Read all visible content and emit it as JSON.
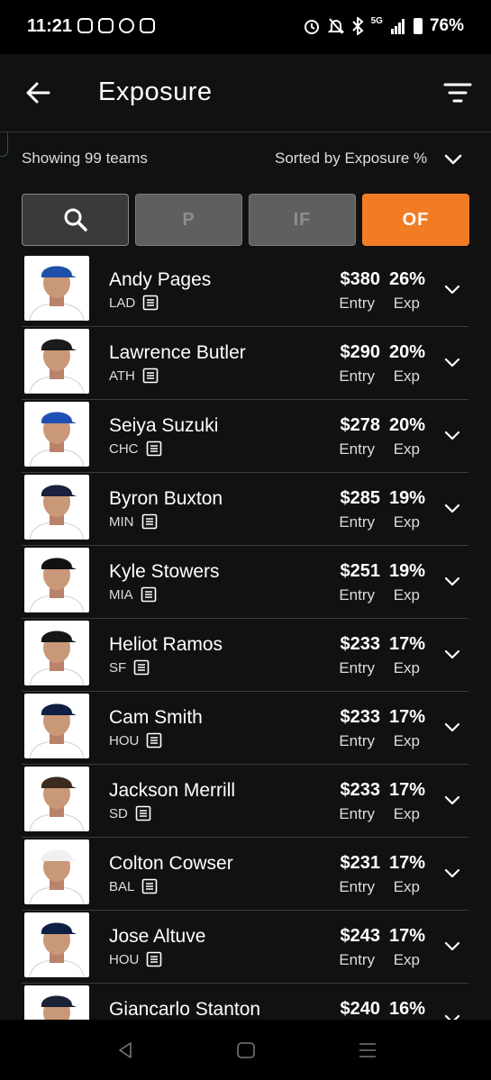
{
  "status_bar": {
    "time": "11:21",
    "network": "5G",
    "battery": "76%"
  },
  "header": {
    "title": "Exposure",
    "back_icon": "arrow-left-icon",
    "filter_icon": "filter-lines-icon"
  },
  "summary": {
    "showing": "Showing 99 teams",
    "sort": "Sorted by Exposure %"
  },
  "tabs": [
    {
      "label": "",
      "icon": "search-icon"
    },
    {
      "label": "P"
    },
    {
      "label": "IF"
    },
    {
      "label": "OF",
      "active": true
    }
  ],
  "colors": {
    "accent": "#f27c23",
    "background": "#111111"
  },
  "players": [
    {
      "name": "Andy Pages",
      "team": "LAD",
      "entry": "$380",
      "entry_label": "Entry",
      "exp": "26%",
      "exp_label": "Exp",
      "cap": "#1e4fa8",
      "jersey": "#ffffff"
    },
    {
      "name": "Lawrence Butler",
      "team": "ATH",
      "entry": "$290",
      "entry_label": "Entry",
      "exp": "20%",
      "exp_label": "Exp",
      "cap": "#1b1b1b",
      "jersey": "#ffffff"
    },
    {
      "name": "Seiya Suzuki",
      "team": "CHC",
      "entry": "$278",
      "entry_label": "Entry",
      "exp": "20%",
      "exp_label": "Exp",
      "cap": "#1f4fb4",
      "jersey": "#ffffff"
    },
    {
      "name": "Byron Buxton",
      "team": "MIN",
      "entry": "$285",
      "entry_label": "Entry",
      "exp": "19%",
      "exp_label": "Exp",
      "cap": "#1c2140",
      "jersey": "#ffffff"
    },
    {
      "name": "Kyle Stowers",
      "team": "MIA",
      "entry": "$251",
      "entry_label": "Entry",
      "exp": "19%",
      "exp_label": "Exp",
      "cap": "#111111",
      "jersey": "#ffffff"
    },
    {
      "name": "Heliot Ramos",
      "team": "SF",
      "entry": "$233",
      "entry_label": "Entry",
      "exp": "17%",
      "exp_label": "Exp",
      "cap": "#161616",
      "jersey": "#ffffff"
    },
    {
      "name": "Cam Smith",
      "team": "HOU",
      "entry": "$233",
      "entry_label": "Entry",
      "exp": "17%",
      "exp_label": "Exp",
      "cap": "#0f1f44",
      "jersey": "#ffffff"
    },
    {
      "name": "Jackson Merrill",
      "team": "SD",
      "entry": "$233",
      "entry_label": "Entry",
      "exp": "17%",
      "exp_label": "Exp",
      "cap": "#3b2a1d",
      "jersey": "#ffffff"
    },
    {
      "name": "Colton Cowser",
      "team": "BAL",
      "entry": "$231",
      "entry_label": "Entry",
      "exp": "17%",
      "exp_label": "Exp",
      "cap": "#f0f0f0",
      "jersey": "#ffffff"
    },
    {
      "name": "Jose Altuve",
      "team": "HOU",
      "entry": "$243",
      "entry_label": "Entry",
      "exp": "17%",
      "exp_label": "Exp",
      "cap": "#0f1f44",
      "jersey": "#ffffff"
    },
    {
      "name": "Giancarlo Stanton",
      "team": "",
      "entry": "$240",
      "entry_label": "",
      "exp": "16%",
      "exp_label": "",
      "cap": "#1a2238",
      "jersey": "#ffffff"
    }
  ],
  "nav": {
    "back": "nav-back-icon",
    "home": "nav-home-icon",
    "recents": "nav-recents-icon"
  }
}
